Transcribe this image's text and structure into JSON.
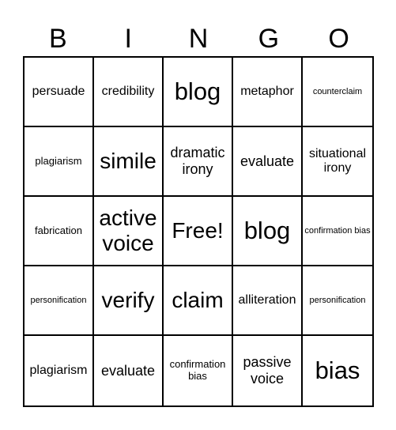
{
  "header": {
    "letters": [
      "B",
      "I",
      "N",
      "G",
      "O"
    ]
  },
  "cells": [
    {
      "text": "persuade",
      "size": "s-md"
    },
    {
      "text": "credibility",
      "size": "s-md"
    },
    {
      "text": "blog",
      "size": "s-xxl"
    },
    {
      "text": "metaphor",
      "size": "s-md"
    },
    {
      "text": "counterclaim",
      "size": "s-xs"
    },
    {
      "text": "plagiarism",
      "size": "s-sm"
    },
    {
      "text": "simile",
      "size": "s-xl"
    },
    {
      "text": "dramatic irony",
      "size": "s-lg"
    },
    {
      "text": "evaluate",
      "size": "s-lg"
    },
    {
      "text": "situational irony",
      "size": "s-md"
    },
    {
      "text": "fabrication",
      "size": "s-sm"
    },
    {
      "text": "active voice",
      "size": "s-xl"
    },
    {
      "text": "Free!",
      "size": "s-xl"
    },
    {
      "text": "blog",
      "size": "s-xxl"
    },
    {
      "text": "confirmation bias",
      "size": "s-xs"
    },
    {
      "text": "personification",
      "size": "s-xs"
    },
    {
      "text": "verify",
      "size": "s-xl"
    },
    {
      "text": "claim",
      "size": "s-xl"
    },
    {
      "text": "alliteration",
      "size": "s-md"
    },
    {
      "text": "personification",
      "size": "s-xs"
    },
    {
      "text": "plagiarism",
      "size": "s-md"
    },
    {
      "text": "evaluate",
      "size": "s-lg"
    },
    {
      "text": "confirmation bias",
      "size": "s-sm"
    },
    {
      "text": "passive voice",
      "size": "s-lg"
    },
    {
      "text": "bias",
      "size": "s-xxl"
    }
  ]
}
